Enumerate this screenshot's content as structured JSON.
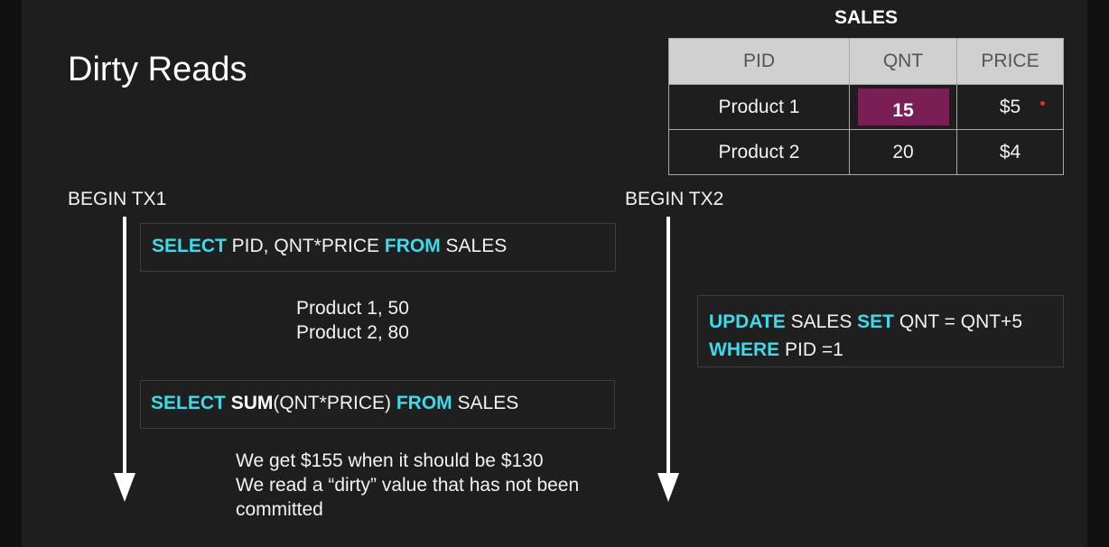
{
  "title": "Dirty Reads",
  "table": {
    "caption": "SALES",
    "headers": [
      "PID",
      "QNT",
      "PRICE"
    ],
    "rows": [
      [
        "Product 1",
        "15",
        "$5"
      ],
      [
        "Product 2",
        "20",
        "$4"
      ]
    ],
    "highlight_color": "#7a1f55"
  },
  "tx1": {
    "label": "BEGIN TX1",
    "query1": {
      "kw1": "SELECT",
      "t1": " PID, QNT*PRICE ",
      "kw2": "FROM",
      "t2": " SALES"
    },
    "result1": [
      "Product 1, 50",
      "Product 2, 80"
    ],
    "query2": {
      "kw1": "SELECT",
      "fn": "SUM",
      "t1": "(QNT*PRICE) ",
      "kw2": "FROM",
      "t2": " SALES"
    },
    "note": [
      "We get $155 when it should be $130",
      "We read a “dirty” value that has not been",
      "committed"
    ]
  },
  "tx2": {
    "label": "BEGIN TX2",
    "update": {
      "kw1": "UPDATE",
      "t1": " SALES ",
      "kw2": "SET",
      "t2": " QNT = QNT+5",
      "kw3": "WHERE",
      "t3": " PID =1"
    }
  },
  "colors": {
    "keyword": "#3fd9e8",
    "background": "#1e1e1e"
  }
}
